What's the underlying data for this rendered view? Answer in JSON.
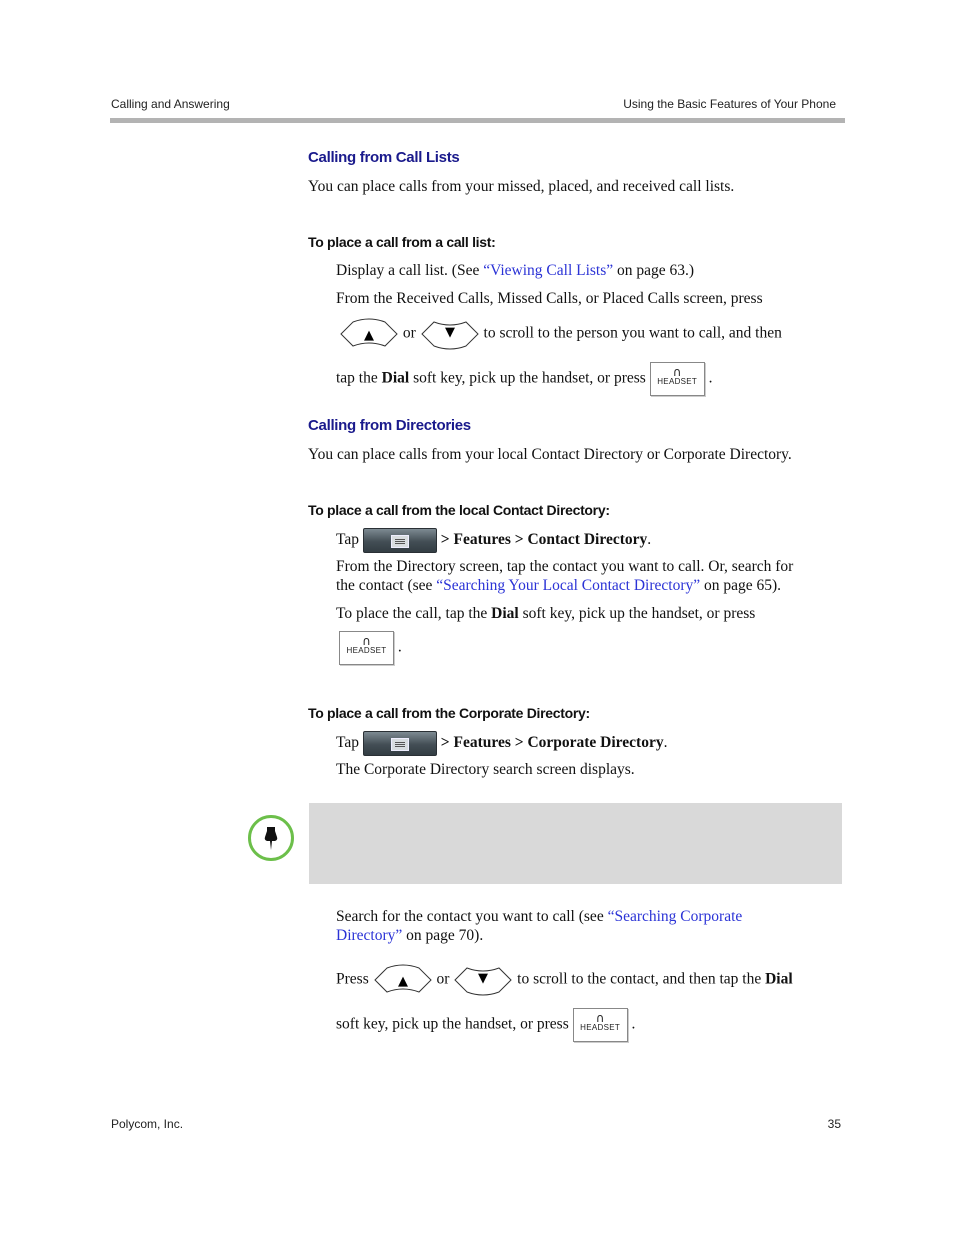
{
  "header": {
    "left": "Calling and Answering",
    "right": "Using the Basic Features of Your Phone"
  },
  "section1": {
    "title": "Calling from Call Lists",
    "intro": "You can place calls from your missed, placed, and received call lists.",
    "proc_title": "To place a call from a call list:",
    "step1": {
      "pre": "Display a call list. (See ",
      "link": "“Viewing Call Lists”",
      "post": " on page 63.)"
    },
    "step2a": "From the Received Calls, Missed Calls, or Placed Calls screen, press",
    "or": "or",
    "step2b": "to scroll to the person you want to call, and then",
    "step2c_pre": "tap the ",
    "dial": "Dial",
    "step2c_post": " soft key, pick up the handset, or press",
    "period": "."
  },
  "section2": {
    "title": "Calling from Directories",
    "intro": "You can place calls from your local Contact Directory or Corporate Directory.",
    "local": {
      "proc_title": "To place a call from the local Contact Directory:",
      "tap": "Tap",
      "path": "> Features > Contact Directory",
      "period": ".",
      "step2_line1": "From the Directory screen, tap the contact you want to call. Or, search for",
      "step2_pre": "the contact (see ",
      "step2_link": "“Searching Your Local Contact Directory”",
      "step2_post": " on page 65).",
      "step3_pre": "To place the call, tap the ",
      "dial": "Dial",
      "step3_post": " soft key, pick up the handset, or press"
    },
    "corporate": {
      "proc_title": "To place a call from the Corporate Directory:",
      "tap": "Tap",
      "path": "> Features > Corporate Directory",
      "period": ".",
      "step2": "The Corporate Directory search screen displays.",
      "step3_pre": "Search for the contact you want to call (see ",
      "step3_link1": "“Searching Corporate",
      "step3_link2": "Directory”",
      "step3_post": " on page 70).",
      "press": "Press",
      "or": "or",
      "step4a_pre": "to scroll to the contact, and then tap the ",
      "dial": "Dial",
      "step4b": "soft key, pick up the handset, or press"
    }
  },
  "icons": {
    "headset_label": "HEADSET",
    "up": "▲",
    "down": "▼"
  },
  "colors": {
    "heading": "#1a1a8c",
    "link": "#2b33d6",
    "note_icon": "#6cbf4a",
    "note_bg": "#d9d9d9"
  },
  "footer": {
    "left": "Polycom, Inc.",
    "page": "35"
  }
}
